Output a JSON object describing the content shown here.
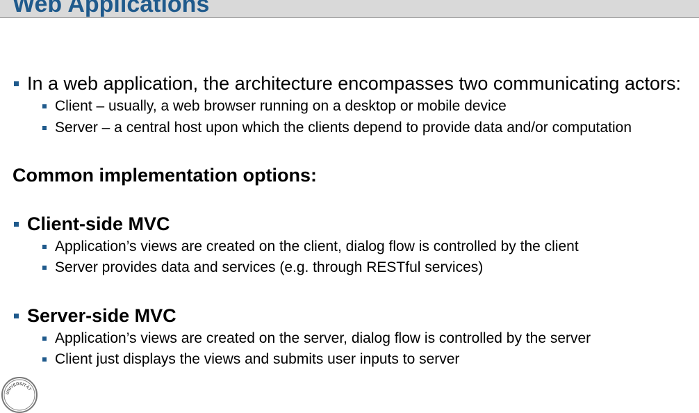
{
  "slide": {
    "title": "Web Applications",
    "intro": {
      "text": "In a web application, the architecture encompasses two communicating actors:",
      "items": [
        "Client – usually, a web browser running on a desktop or mobile device",
        "Server – a central host upon which the clients depend to provide data and/or computation"
      ]
    },
    "options_heading": "Common implementation options:",
    "client_mvc": {
      "heading": "Client-side MVC",
      "items": [
        "Application’s views are created on the client, dialog flow is controlled by the client",
        "Server provides data and services (e.g. through RESTful services)"
      ]
    },
    "server_mvc": {
      "heading": "Server-side MVC",
      "items": [
        "Application’s views are created on the server, dialog flow is controlled by the server",
        "Client just displays the views and submits user inputs to server"
      ]
    },
    "logo_text": "UNIVERSITÄT"
  },
  "colors": {
    "accent": "#1f5a8c",
    "topbar": "#d9d9d9"
  }
}
